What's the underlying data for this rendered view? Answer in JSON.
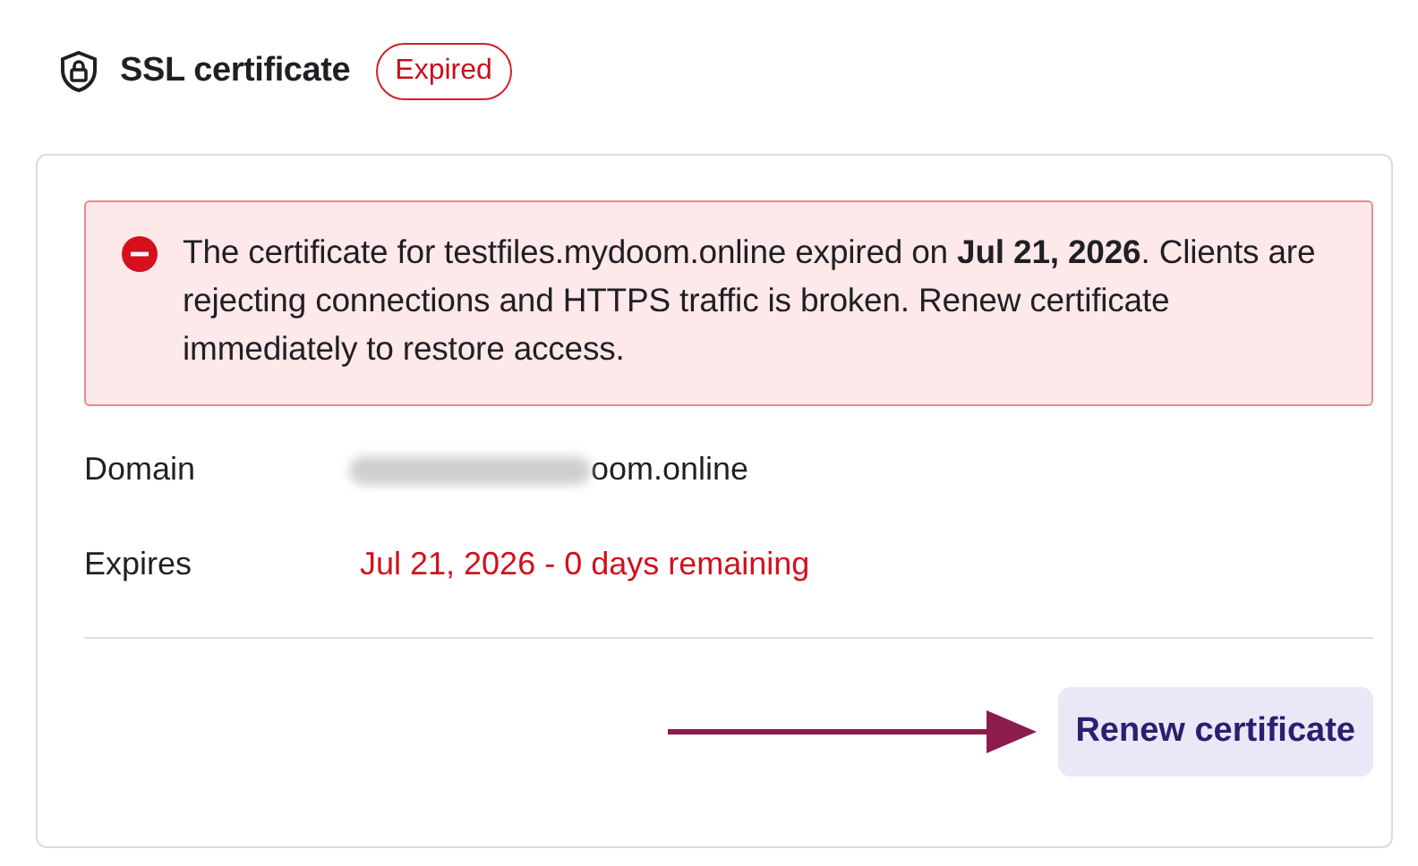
{
  "header": {
    "title": "SSL certificate",
    "badge": "Expired"
  },
  "alert": {
    "message": "The certificate for testfiles.mydoom.online expired on **Jul 21, 2026**. Clients are rejecting connections and HTTPS traffic is broken. Renew certificate immediately to restore access."
  },
  "details": [
    {
      "label": "Domain",
      "value": "oom.online",
      "kind": "redacted"
    },
    {
      "label": "Expires",
      "value": "Jul 21, 2026 - 0 days remaining",
      "kind": "warning"
    }
  ],
  "button": {
    "label": "Renew certificate"
  }
}
